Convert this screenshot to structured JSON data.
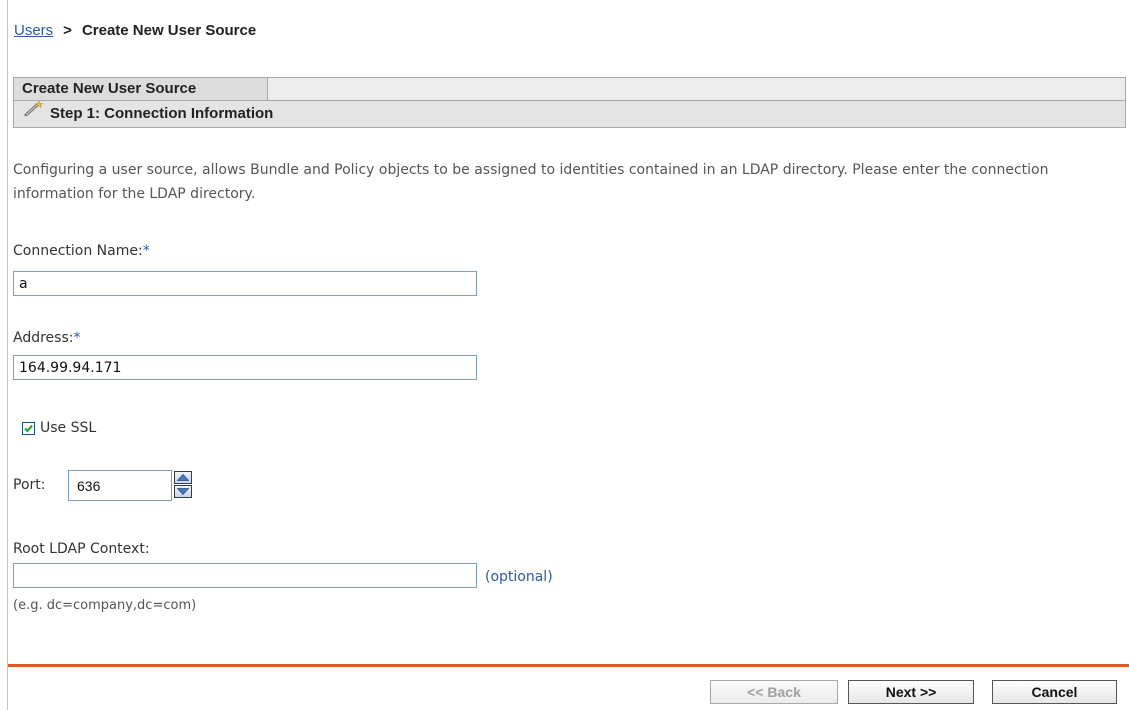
{
  "breadcrumb": {
    "link": "Users",
    "separator": ">",
    "current": "Create New User Source"
  },
  "panel": {
    "tab_title": "Create New User Source",
    "step_title": "Step 1: Connection Information",
    "step_icon": "wizard-wand-icon"
  },
  "description": "Configuring a user source, allows Bundle and Policy objects to be assigned to identities contained in an LDAP directory. Please enter the connection information for the LDAP directory.",
  "form": {
    "connection_name": {
      "label": "Connection Name:",
      "required_mark": "*",
      "value": "a"
    },
    "address": {
      "label": "Address:",
      "required_mark": "*",
      "value": "164.99.94.171"
    },
    "use_ssl": {
      "label": "Use SSL",
      "checked": true
    },
    "port": {
      "label": "Port:",
      "value": "636"
    },
    "root_context": {
      "label": "Root LDAP Context:",
      "value": "",
      "optional_text": "(optional)",
      "hint": "(e.g. dc=company,dc=com)"
    }
  },
  "buttons": {
    "back": "<< Back",
    "next": "Next >>",
    "cancel": "Cancel"
  },
  "colors": {
    "accent_rule": "#e05a1f",
    "link": "#2b59a6",
    "panel_bg": "#e4e4e4"
  }
}
